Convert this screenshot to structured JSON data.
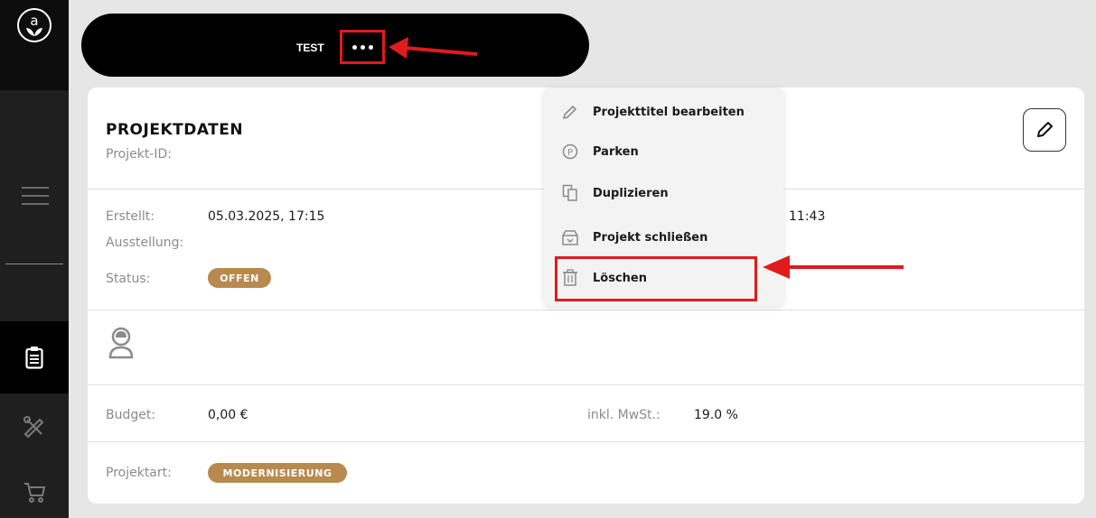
{
  "sidebar": {
    "logo_letter": "a",
    "icons": [
      "logo-icon",
      "menu-icon",
      "clipboard-icon",
      "tools-icon",
      "cart-icon"
    ]
  },
  "header": {
    "title": "TEST",
    "more_icon": "more-dots-icon"
  },
  "project": {
    "section_title": "PROJEKTDATEN",
    "id_label": "Projekt-ID:",
    "created_label": "Erstellt:",
    "created_value": "05.03.2025, 17:15",
    "exhibition_label": "Ausstellung:",
    "updated_time_partial": "11:43",
    "status_label": "Status:",
    "status_value": "OFFEN",
    "budget_label": "Budget:",
    "budget_value": "0,00 €",
    "vat_label": "inkl. MwSt.:",
    "vat_value": "19.0 %",
    "type_label": "Projektart:",
    "type_value": "MODERNISIERUNG"
  },
  "dropdown": {
    "items": [
      {
        "label": "Projekttitel bearbeiten",
        "icon": "pencil-icon"
      },
      {
        "label": "Parken",
        "icon": "parking-icon"
      },
      {
        "label": "Duplizieren",
        "icon": "duplicate-icon"
      },
      {
        "label": "Projekt schließen",
        "icon": "close-project-icon"
      },
      {
        "label": "Löschen",
        "icon": "trash-icon"
      }
    ]
  },
  "colors": {
    "badge": "#b98a4e",
    "highlight": "#e01b1b",
    "sidebar": "#1f1f1f"
  }
}
